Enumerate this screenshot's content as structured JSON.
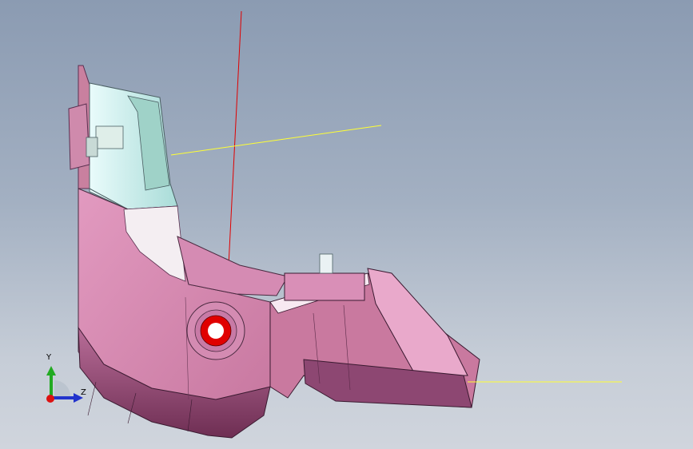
{
  "viewport": {
    "background_top": "#8b9bb2",
    "background_bottom": "#d0d5dd"
  },
  "model": {
    "body_color": "#d48bb2",
    "body_shade_color": "#a35d86",
    "glass_color": "#cfeff0",
    "hole_ring_color": "#e00000",
    "axis_line_colors": [
      "#e00000",
      "#ffff33"
    ]
  },
  "triad": {
    "y_label": "Y",
    "z_label": "Z",
    "y_color": "#22aa22",
    "z_color": "#2233cc",
    "origin_color": "#dd1111"
  }
}
